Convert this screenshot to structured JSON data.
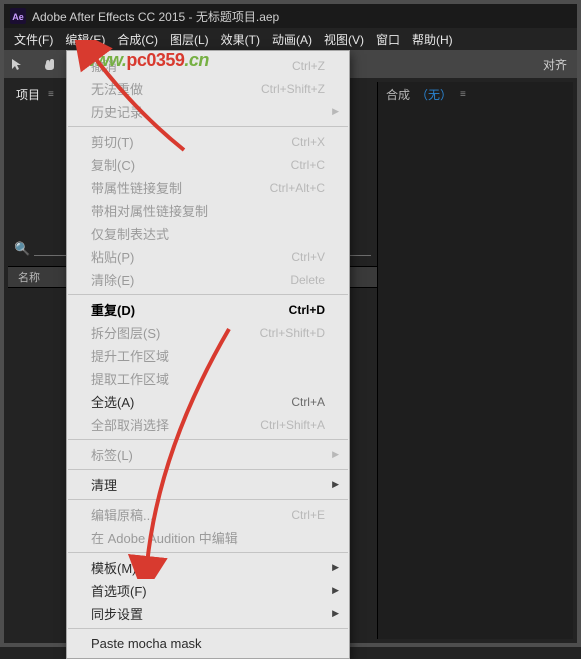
{
  "title": "Adobe After Effects CC 2015 - 无标题项目.aep",
  "menubar": [
    "文件(F)",
    "编辑(E)",
    "合成(C)",
    "图层(L)",
    "效果(T)",
    "动画(A)",
    "视图(V)",
    "窗口",
    "帮助(H)"
  ],
  "toolbar_align": "对齐",
  "watermark": {
    "a": "www.",
    "b": "pc0359",
    "c": ".cn"
  },
  "left_panel": {
    "tab": "项目",
    "menu_glyph": "≡",
    "search_placeholder": "",
    "col_header": "名称"
  },
  "right_panel": {
    "tab": "合成",
    "none": "（无）",
    "menu_glyph": "≡"
  },
  "menu": {
    "items": [
      {
        "label": "撤消",
        "shortcut": "Ctrl+Z",
        "enabled": false
      },
      {
        "label": "无法重做",
        "shortcut": "Ctrl+Shift+Z",
        "enabled": false
      },
      {
        "label": "历史记录",
        "shortcut": "",
        "enabled": false,
        "submenu": true
      },
      {
        "divider": true
      },
      {
        "label": "剪切(T)",
        "shortcut": "Ctrl+X",
        "enabled": false
      },
      {
        "label": "复制(C)",
        "shortcut": "Ctrl+C",
        "enabled": false
      },
      {
        "label": "带属性链接复制",
        "shortcut": "Ctrl+Alt+C",
        "enabled": false
      },
      {
        "label": "带相对属性链接复制",
        "shortcut": "",
        "enabled": false
      },
      {
        "label": "仅复制表达式",
        "shortcut": "",
        "enabled": false
      },
      {
        "label": "粘贴(P)",
        "shortcut": "Ctrl+V",
        "enabled": false
      },
      {
        "label": "清除(E)",
        "shortcut": "Delete",
        "enabled": false
      },
      {
        "divider": true
      },
      {
        "label": "重复(D)",
        "shortcut": "Ctrl+D",
        "enabled": true,
        "bold": true
      },
      {
        "label": "拆分图层(S)",
        "shortcut": "Ctrl+Shift+D",
        "enabled": false
      },
      {
        "label": "提升工作区域",
        "shortcut": "",
        "enabled": false
      },
      {
        "label": "提取工作区域",
        "shortcut": "",
        "enabled": false
      },
      {
        "label": "全选(A)",
        "shortcut": "Ctrl+A",
        "enabled": true
      },
      {
        "label": "全部取消选择",
        "shortcut": "Ctrl+Shift+A",
        "enabled": false
      },
      {
        "divider": true
      },
      {
        "label": "标签(L)",
        "shortcut": "",
        "enabled": false,
        "submenu": true
      },
      {
        "divider": true
      },
      {
        "label": "清理",
        "shortcut": "",
        "enabled": true,
        "submenu": true
      },
      {
        "divider": true
      },
      {
        "label": "编辑原稿...",
        "shortcut": "Ctrl+E",
        "enabled": false
      },
      {
        "label": "在 Adobe Audition 中编辑",
        "shortcut": "",
        "enabled": false
      },
      {
        "divider": true
      },
      {
        "label": "模板(M)",
        "shortcut": "",
        "enabled": true,
        "submenu": true
      },
      {
        "label": "首选项(F)",
        "shortcut": "",
        "enabled": true,
        "submenu": true
      },
      {
        "label": "同步设置",
        "shortcut": "",
        "enabled": true,
        "submenu": true
      },
      {
        "divider": true
      },
      {
        "label": "Paste mocha mask",
        "shortcut": "",
        "enabled": true
      }
    ]
  }
}
